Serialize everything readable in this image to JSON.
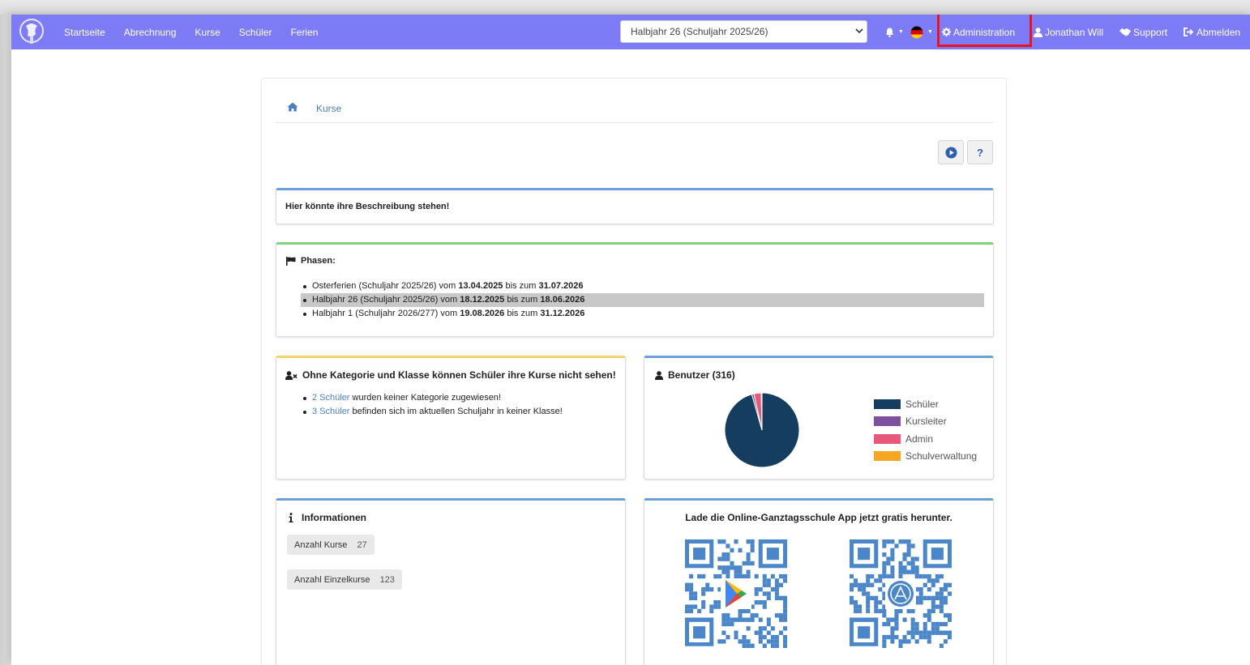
{
  "nav": {
    "links": [
      "Startseite",
      "Abrechnung",
      "Kurse",
      "Schüler",
      "Ferien"
    ],
    "period_select": "Halbjahr 26 (Schuljahr 2025/26)",
    "administration": "Administration",
    "user": "Jonathan Will",
    "support": "Support",
    "logout": "Abmelden"
  },
  "breadcrumb": {
    "current": "Kurse"
  },
  "toolbar": {
    "help_label": "?"
  },
  "description": {
    "text": "Hier könnte ihre Beschreibung stehen!"
  },
  "phases": {
    "title": "Phasen:",
    "items": [
      {
        "name": "Osterferien (Schuljahr 2025/26)",
        "from_word": "vom",
        "from": "13.04.2025",
        "to_word": "bis zum",
        "to": "31.07.2026",
        "active": false
      },
      {
        "name": "Halbjahr 26 (Schuljahr 2025/26)",
        "from_word": "vom",
        "from": "18.12.2025",
        "to_word": "bis zum",
        "to": "18.06.2026",
        "active": true
      },
      {
        "name": "Halbjahr 1 (Schuljahr 2026/277)",
        "from_word": "vom",
        "from": "19.08.2026",
        "to_word": "bis zum",
        "to": "31.12.2026",
        "active": false
      }
    ]
  },
  "warning": {
    "title": "Ohne Kategorie und Klasse können Schüler ihre Kurse nicht sehen!",
    "items": [
      {
        "link": "2 Schüler",
        "text": " wurden keiner Kategorie zugewiesen!"
      },
      {
        "link": "3 Schüler",
        "text": " befinden sich im aktuellen Schuljahr in keiner Klasse!"
      }
    ]
  },
  "users": {
    "title": "Benutzer (316)",
    "legend": [
      {
        "label": "Schüler",
        "color": "#143d5f"
      },
      {
        "label": "Kursleiter",
        "color": "#7d4f9e"
      },
      {
        "label": "Admin",
        "color": "#e8587a"
      },
      {
        "label": "Schulverwaltung",
        "color": "#f5a623"
      }
    ]
  },
  "chart_data": {
    "type": "pie",
    "categories": [
      "Schüler",
      "Kursleiter",
      "Admin",
      "Schulverwaltung"
    ],
    "values": [
      302,
      3,
      10,
      1
    ],
    "legend": "right"
  },
  "info": {
    "title": "Informationen",
    "courses_label": "Anzahl Kurse",
    "courses_value": "27",
    "single_label": "Anzahl Einzelkurse",
    "single_value": "123"
  },
  "app": {
    "title": "Lade die Online-Ganztagsschule App jetzt gratis herunter."
  }
}
